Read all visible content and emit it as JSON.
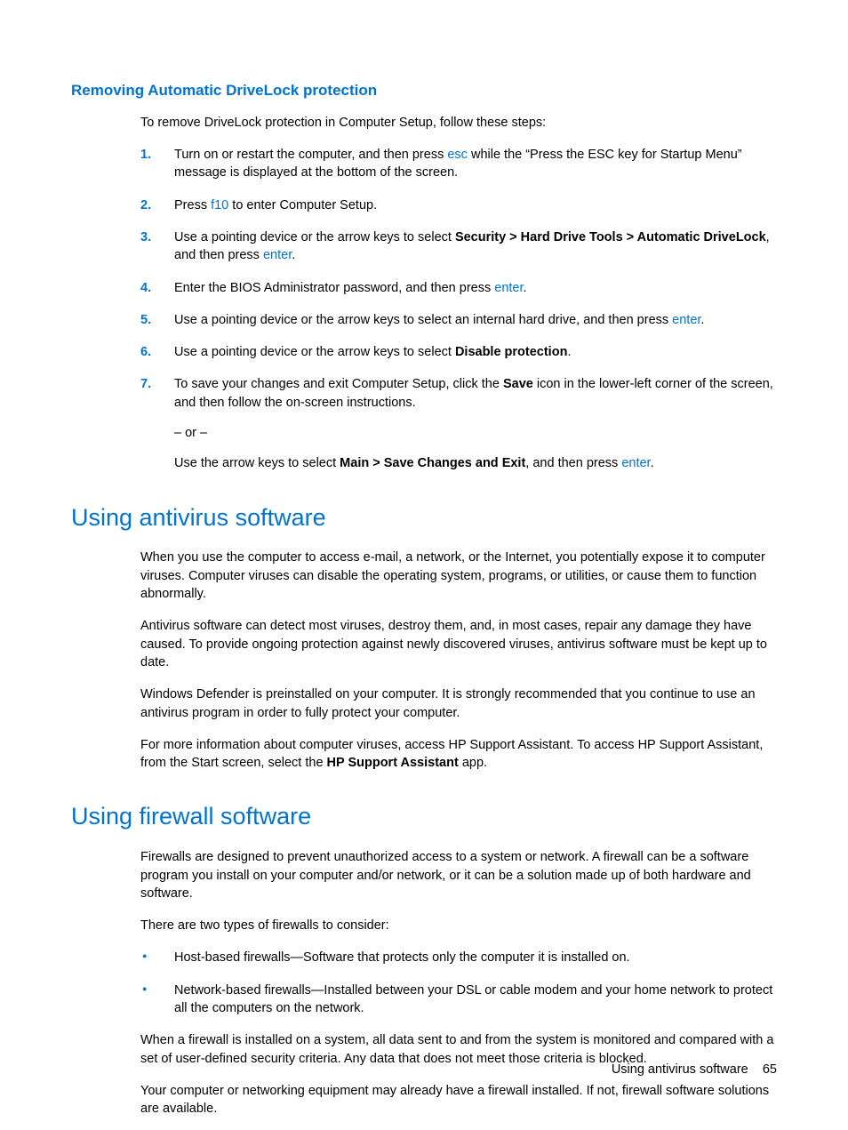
{
  "sec1": {
    "title": "Removing Automatic DriveLock protection",
    "intro": "To remove DriveLock protection in Computer Setup, follow these steps:",
    "step1_a": "Turn on or restart the computer, and then press ",
    "step1_key": "esc",
    "step1_b": " while the “Press the ESC key for Startup Menu” message is displayed at the bottom of the screen.",
    "step2_a": "Press ",
    "step2_key": "f10",
    "step2_b": " to enter Computer Setup.",
    "step3_a": "Use a pointing device or the arrow keys to select ",
    "step3_bold": "Security > Hard Drive Tools > Automatic DriveLock",
    "step3_b": ", and then press ",
    "step3_key": "enter",
    "step3_c": ".",
    "step4_a": "Enter the BIOS Administrator password, and then press ",
    "step4_key": "enter",
    "step4_b": ".",
    "step5_a": "Use a pointing device or the arrow keys to select an internal hard drive, and then press ",
    "step5_key": "enter",
    "step5_b": ".",
    "step6_a": "Use a pointing device or the arrow keys to select ",
    "step6_bold": "Disable protection",
    "step6_b": ".",
    "step7_a": "To save your changes and exit Computer Setup, click the ",
    "step7_bold": "Save",
    "step7_b": " icon in the lower-left corner of the screen, and then follow the on-screen instructions.",
    "step7_or": "– or –",
    "step7_c": "Use the arrow keys to select ",
    "step7_bold2": "Main > Save Changes and Exit",
    "step7_d": ", and then press ",
    "step7_key2": "enter",
    "step7_e": "."
  },
  "sec2": {
    "title": "Using antivirus software",
    "p1": "When you use the computer to access e-mail, a network, or the Internet, you potentially expose it to computer viruses. Computer viruses can disable the operating system, programs, or utilities, or cause them to function abnormally.",
    "p2": "Antivirus software can detect most viruses, destroy them, and, in most cases, repair any damage they have caused. To provide ongoing protection against newly discovered viruses, antivirus software must be kept up to date.",
    "p3": "Windows Defender is preinstalled on your computer. It is strongly recommended that you continue to use an antivirus program in order to fully protect your computer.",
    "p4_a": "For more information about computer viruses, access HP Support Assistant. To access HP Support Assistant, from the Start screen, select the ",
    "p4_bold": "HP Support Assistant",
    "p4_b": " app."
  },
  "sec3": {
    "title": "Using firewall software",
    "p1": "Firewalls are designed to prevent unauthorized access to a system or network. A firewall can be a software program you install on your computer and/or network, or it can be a solution made up of both hardware and software.",
    "p2": "There are two types of firewalls to consider:",
    "b1": "Host-based firewalls—Software that protects only the computer it is installed on.",
    "b2": "Network-based firewalls—Installed between your DSL or cable modem and your home network to protect all the computers on the network.",
    "p3": "When a firewall is installed on a system, all data sent to and from the system is monitored and compared with a set of user-defined security criteria. Any data that does not meet those criteria is blocked.",
    "p4": "Your computer or networking equipment may already have a firewall installed. If not, firewall software solutions are available."
  },
  "footer": {
    "label": "Using antivirus software",
    "page": "65"
  }
}
